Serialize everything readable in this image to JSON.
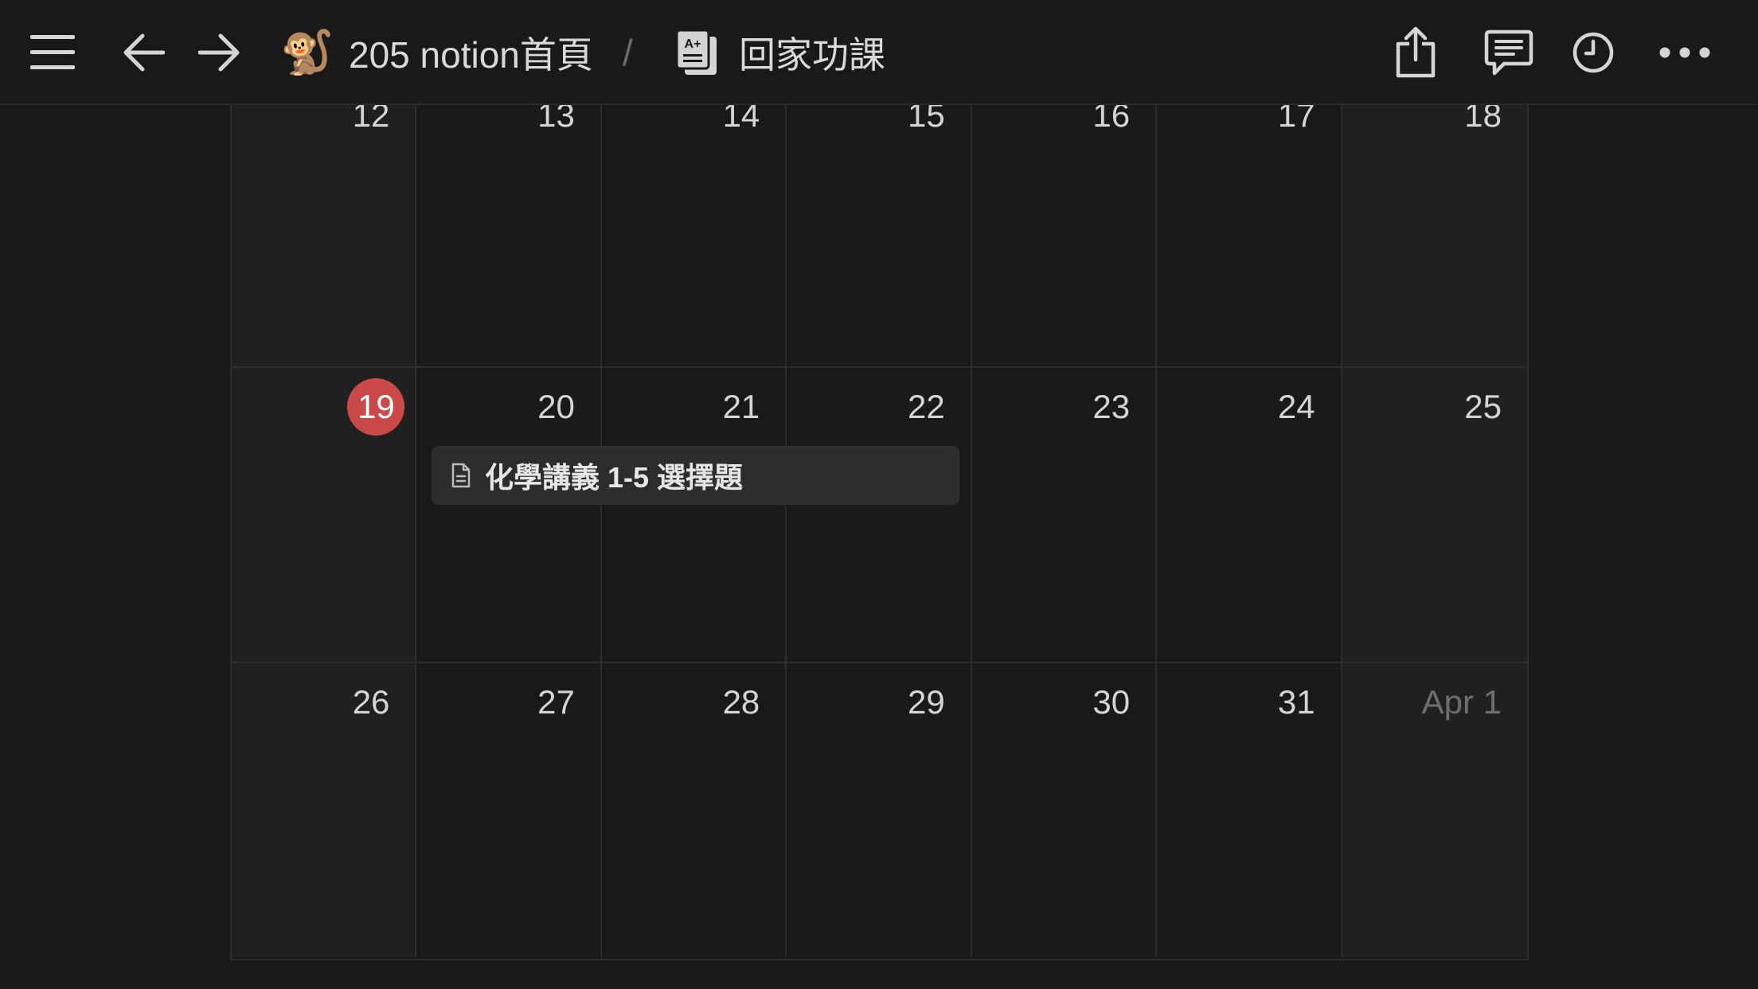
{
  "topbar": {
    "workspace_emoji": "🐒",
    "workspace_title": "205 notion首頁",
    "separator": "/",
    "page_title": "回家功課",
    "icons": [
      "menu-icon",
      "back-arrow-icon",
      "forward-arrow-icon",
      "share-icon",
      "comment-icon",
      "history-icon",
      "more-icon"
    ]
  },
  "calendar": {
    "today": "19",
    "weeks": [
      [
        "12",
        "13",
        "14",
        "15",
        "16",
        "17",
        "18"
      ],
      [
        "19",
        "20",
        "21",
        "22",
        "23",
        "24",
        "25"
      ],
      [
        "26",
        "27",
        "28",
        "29",
        "30",
        "31",
        "Apr 1"
      ]
    ],
    "events": [
      {
        "title": "化學講義 1-5 選擇題",
        "icon": "page-icon"
      }
    ]
  },
  "colors": {
    "background": "#191919",
    "weekend": "#202020",
    "today_badge": "#c94a49",
    "event_bg": "#2c2c2c"
  }
}
